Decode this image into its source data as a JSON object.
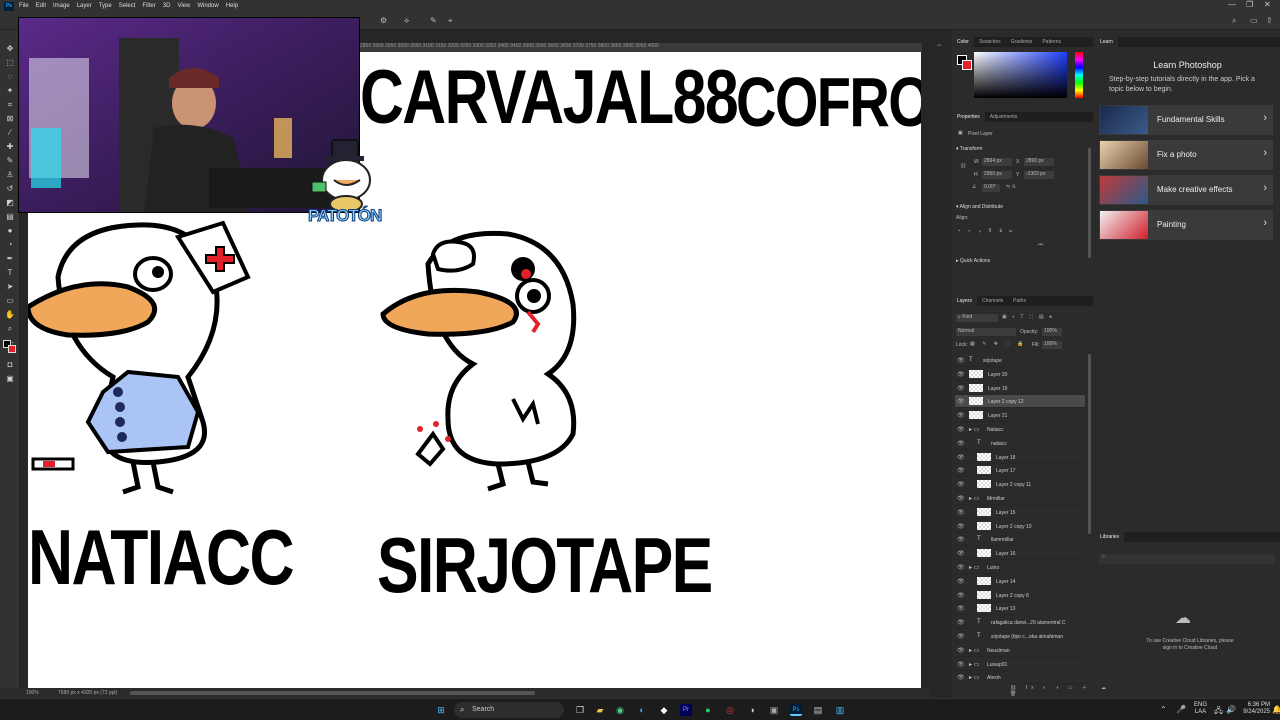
{
  "menubar": {
    "app_icon": "Ps",
    "items": [
      "File",
      "Edit",
      "Image",
      "Layer",
      "Type",
      "Select",
      "Filter",
      "3D",
      "View",
      "Window",
      "Help"
    ],
    "controls": [
      "—",
      "❐",
      "✕"
    ]
  },
  "ruler": {
    "ticks": "2850    2900    2950    3000    3050    3100    3150    3200    3250    3300    3350    3400    3450    3500    3550    3600    3650    3700    3750    3800    3850    3900    3950    4000"
  },
  "canvas": {
    "labels": {
      "carvajal": "CARVAJAL88",
      "cofroxx": "COFROXX",
      "natiacc": "NATIACC",
      "sirjotape": "SIRJOTAPE"
    },
    "sticker_text": "PATOTÓN"
  },
  "statusbar": {
    "zoom": "100%",
    "doc_size": "7680 px x 4320 px (72 ppi)"
  },
  "color_panel": {
    "tabs": [
      "Color",
      "Swatches",
      "Gradients",
      "Patterns"
    ]
  },
  "properties_panel": {
    "tabs": [
      "Properties",
      "Adjustments"
    ],
    "layer_type": "Pixel Layer",
    "transform_title": "Transform",
    "w_label": "W",
    "w_value": "2894 px",
    "h_label": "H",
    "h_value": "2950 px",
    "x_label": "X",
    "x_value": "2890 px",
    "y_label": "Y",
    "y_value": "-2303 px",
    "angle_value": "0.00°",
    "align_title": "Align and Distribute",
    "align_label": "Align:",
    "quick_actions_title": "Quick Actions"
  },
  "layers_panel": {
    "tabs": [
      "Layers",
      "Channels",
      "Paths"
    ],
    "filter_kind": "Kind",
    "blend_mode": "Normal",
    "opacity_label": "Opacity:",
    "opacity_value": "100%",
    "lock_label": "Lock:",
    "fill_label": "Fill:",
    "fill_value": "100%",
    "layers": [
      {
        "name": "sirjotape",
        "kind": "text",
        "indent": 0
      },
      {
        "name": "Layer 20",
        "kind": "pixel",
        "indent": 0
      },
      {
        "name": "Layer 19",
        "kind": "pixel",
        "indent": 0
      },
      {
        "name": "Layer 2 copy 12",
        "kind": "pixel",
        "indent": 0,
        "selected": true
      },
      {
        "name": "Layer 21",
        "kind": "pixel",
        "indent": 0
      },
      {
        "name": "Natiacc",
        "kind": "group",
        "indent": 0
      },
      {
        "name": "natiacc",
        "kind": "text",
        "indent": 1
      },
      {
        "name": "Layer 18",
        "kind": "pixel",
        "indent": 1
      },
      {
        "name": "Layer 17",
        "kind": "pixel",
        "indent": 1
      },
      {
        "name": "Layer 2 copy 11",
        "kind": "pixel",
        "indent": 1
      },
      {
        "name": "Mrmillar",
        "kind": "group",
        "indent": 0
      },
      {
        "name": "Layer 15",
        "kind": "pixel",
        "indent": 1
      },
      {
        "name": "Layer 2 copy 10",
        "kind": "pixel",
        "indent": 1
      },
      {
        "name": "llamrmillar",
        "kind": "text",
        "indent": 1
      },
      {
        "name": "Layer 16",
        "kind": "pixel",
        "indent": 1
      },
      {
        "name": "Luino",
        "kind": "group",
        "indent": 0
      },
      {
        "name": "Layer 14",
        "kind": "pixel",
        "indent": 1
      },
      {
        "name": "Layer 2 copy 8",
        "kind": "pixel",
        "indent": 1
      },
      {
        "name": "Layer 13",
        "kind": "pixel",
        "indent": 1
      },
      {
        "name": "rafagalica darwi...29 alamentral C",
        "kind": "text",
        "indent": 1
      },
      {
        "name": "sirjotape (tipo c...eka almahiman",
        "kind": "text",
        "indent": 1
      },
      {
        "name": "Neuslman",
        "kind": "group",
        "indent": 0
      },
      {
        "name": "Luisap91",
        "kind": "group",
        "indent": 0
      },
      {
        "name": "Alexin",
        "kind": "group",
        "indent": 0
      }
    ]
  },
  "learn_panel": {
    "tab": "Learn",
    "title": "Learn Photoshop",
    "subtitle": "Step-by-step tutorials directly in the app. Pick a topic below to begin.",
    "items": [
      {
        "label": "Fundamental Skills"
      },
      {
        "label": "Fix a photo"
      },
      {
        "label": "Make creative effects"
      },
      {
        "label": "Painting"
      }
    ]
  },
  "libraries_panel": {
    "tab": "Libraries",
    "message": "To use Creative Cloud Libraries, please sign in to Creative Cloud"
  },
  "taskbar": {
    "search_placeholder": "Search",
    "lang_top": "ENG",
    "lang_bottom": "LAA",
    "time": "6:36 PM",
    "date": "9/24/2025"
  }
}
